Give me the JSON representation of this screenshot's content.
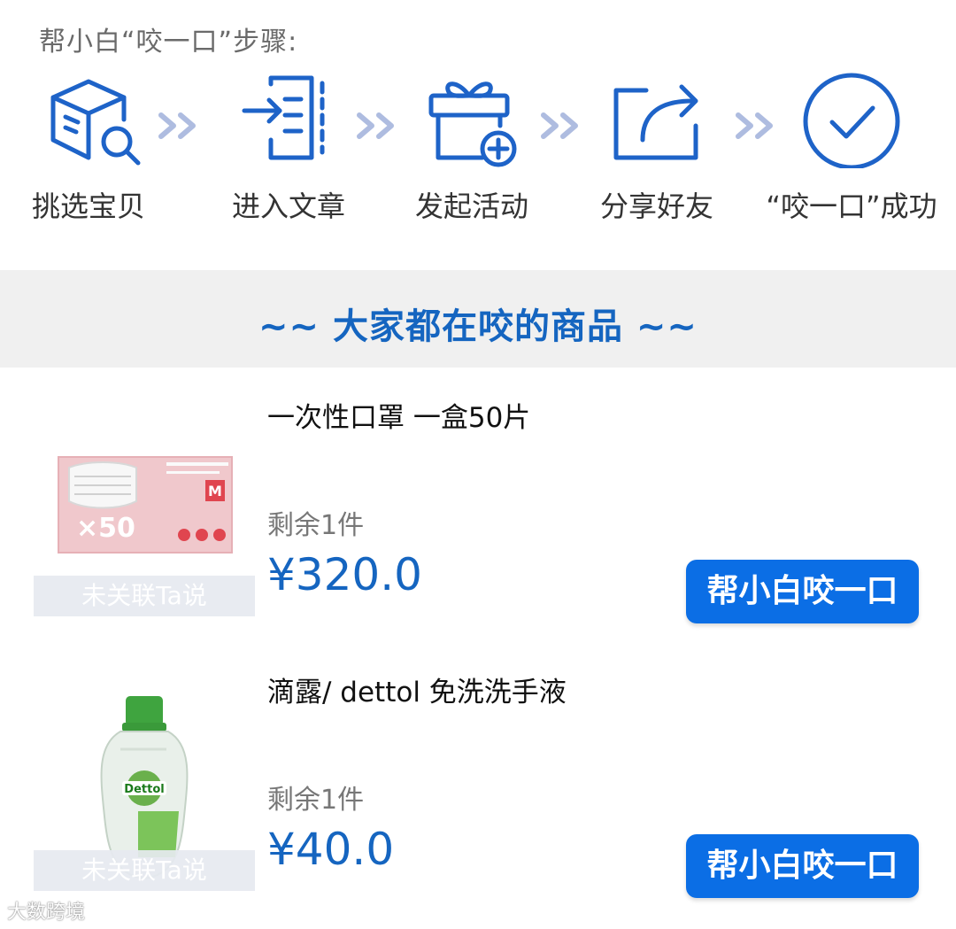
{
  "steps": {
    "title": "帮小白“咬一口”步骤:",
    "items": [
      {
        "label": "挑选宝贝",
        "icon": "box-search-icon"
      },
      {
        "label": "进入文章",
        "icon": "enter-article-icon"
      },
      {
        "label": "发起活动",
        "icon": "gift-add-icon"
      },
      {
        "label": "分享好友",
        "icon": "share-icon"
      },
      {
        "label": "“咬一口”成功",
        "icon": "check-circle-icon"
      }
    ]
  },
  "section": {
    "title": "~~ 大家都在咬的商品 ~~"
  },
  "products": [
    {
      "name": "一次性口罩 一盒50片",
      "stock": "剩余1件",
      "price": "¥320.0",
      "button": "帮小白咬一口",
      "tag": "未关联Ta说",
      "image": {
        "label": "×50",
        "size_mark": "M"
      }
    },
    {
      "name": "滴露/ dettol 免洗洗手液",
      "stock": "剩余1件",
      "price": "¥40.0",
      "button": "帮小白咬一口",
      "tag": "未关联Ta说",
      "image": {
        "label": "Dettol"
      }
    }
  ],
  "watermark": "大数跨境",
  "colors": {
    "accent": "#1565c0",
    "button": "#0b6ee5",
    "icon": "#1e63c8",
    "band": "#f0f0f0"
  }
}
